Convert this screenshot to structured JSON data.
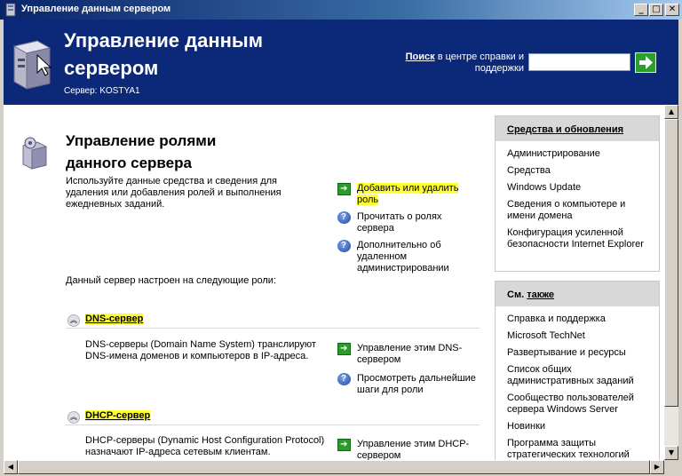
{
  "window": {
    "title": "Управление данным сервером",
    "controls": {
      "minimize": "_",
      "maximize": "□",
      "close": "✕"
    }
  },
  "header": {
    "title": "Управление данным сервером",
    "server_label": "Сервер:",
    "server_name": "KOSTYA1",
    "search_label_bold": "Поиск",
    "search_label_rest": " в центре справки и поддержки",
    "search_value": ""
  },
  "main": {
    "title": "Управление ролями данного сервера",
    "description": "Используйте данные средства и сведения для удаления или добавления ролей и выполнения ежедневных заданий.",
    "tasks": [
      {
        "icon": "arrow-icon",
        "label": "Добавить или удалить роль"
      },
      {
        "icon": "help-icon",
        "label": "Прочитать о ролях сервера"
      },
      {
        "icon": "help-icon",
        "label": "Дополнительно об удаленном администрировании"
      }
    ],
    "configured_text": "Данный сервер настроен на следующие роли:",
    "roles": [
      {
        "name": "DNS-сервер",
        "description": "DNS-серверы (Domain Name System) транслируют DNS-имена доменов и компьютеров в IP-адреса.",
        "tasks": [
          {
            "icon": "arrow-icon",
            "label": "Управление этим DNS-сервером"
          },
          {
            "icon": "help-icon",
            "label": "Просмотреть дальнейшие шаги для роли"
          }
        ]
      },
      {
        "name": "DHCP-сервер",
        "description": "DHCP-серверы (Dynamic Host Configuration Protocol) назначают IP-адреса сетевым клиентам.",
        "tasks": [
          {
            "icon": "arrow-icon",
            "label": "Управление этим DHCP-сервером"
          }
        ]
      }
    ]
  },
  "sidebar": {
    "tools": {
      "title": "Средства и обновления",
      "items": [
        "Администрирование",
        "Средства",
        "Windows Update",
        "Сведения о компьютере и имени домена",
        "Конфигурация усиленной безопасности Internet Explorer"
      ]
    },
    "see_also": {
      "title_prefix": "См. ",
      "title_underlined": "также",
      "items": [
        "Справка и поддержка",
        "Microsoft TechNet",
        "Развертывание и ресурсы",
        "Список общих административных заданий",
        "Сообщество пользователей сервера Windows Server",
        "Новинки",
        "Программа защиты стратегических технологий"
      ]
    }
  },
  "colors": {
    "header_bg": "#0c2878",
    "highlight": "#ffff33",
    "arrow": "#2a9a2a",
    "help": "#1c4aa8"
  }
}
